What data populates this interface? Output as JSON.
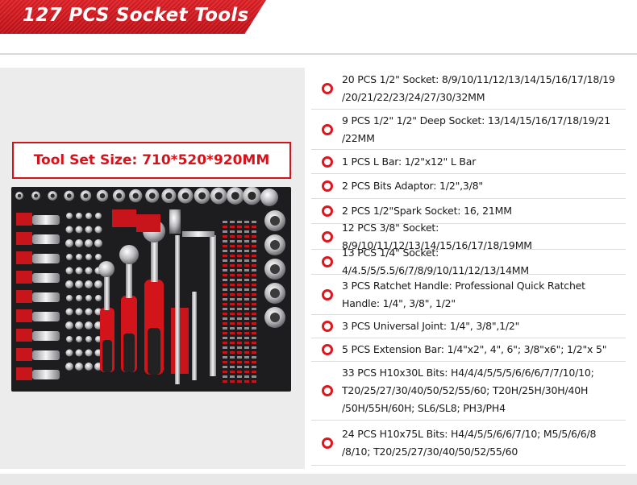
{
  "banner": {
    "title": "127 PCS Socket Tools"
  },
  "tool_set": {
    "size_label": "Tool Set Size: 710*520*920MM"
  },
  "items": [
    {
      "line1": "20 PCS 1/2\" Socket: 8/9/10/11/12/13/14/15/16/17/18/19",
      "line2": "/20/21/22/23/24/27/30/32MM"
    },
    {
      "line1": "9 PCS 1/2\" 1/2\" Deep Socket: 13/14/15/16/17/18/19/21",
      "line2": "/22MM"
    },
    {
      "line1": "1 PCS L Bar: 1/2\"x12\" L Bar"
    },
    {
      "line1": "2 PCS Bits Adaptor: 1/2\",3/8\""
    },
    {
      "line1": "2 PCS 1/2\"Spark Socket: 16, 21MM"
    },
    {
      "line1": "12 PCS 3/8\" Socket: 8/9/10/11/12/13/14/15/16/17/18/19MM"
    },
    {
      "line1": "13 PCS 1/4\" Socket: 4/4.5/5/5.5/6/7/8/9/10/11/12/13/14MM"
    },
    {
      "line1": "3 PCS Ratchet Handle: Professional Quick Ratchet",
      "line2": "Handle: 1/4\", 3/8\", 1/2\""
    },
    {
      "line1": "3 PCS Universal Joint: 1/4\", 3/8\",1/2\""
    },
    {
      "line1": "5 PCS Extension Bar: 1/4\"x2\", 4\", 6\"; 3/8\"x6\"; 1/2\"x 5\""
    },
    {
      "line1": "33 PCS H10x30L Bits: H4/4/4/5/5/5/6/6/6/7/7/10/10;",
      "line2": "T20/25/27/30/40/50/52/55/60; T20H/25H/30H/40H",
      "line3": "/50H/55H/60H; SL6/SL8; PH3/PH4"
    },
    {
      "line1": "24 PCS H10x75L Bits: H4/4/5/5/6/6/7/10; M5/5/6/6/8",
      "line2": "/8/10; T20/25/27/30/40/50/52/55/60"
    }
  ],
  "colors": {
    "accent": "#e0161e",
    "panel": "#ececec",
    "tray": "#1d1d1f"
  },
  "icons": {
    "bullet": "red-ring-bullet-icon"
  }
}
